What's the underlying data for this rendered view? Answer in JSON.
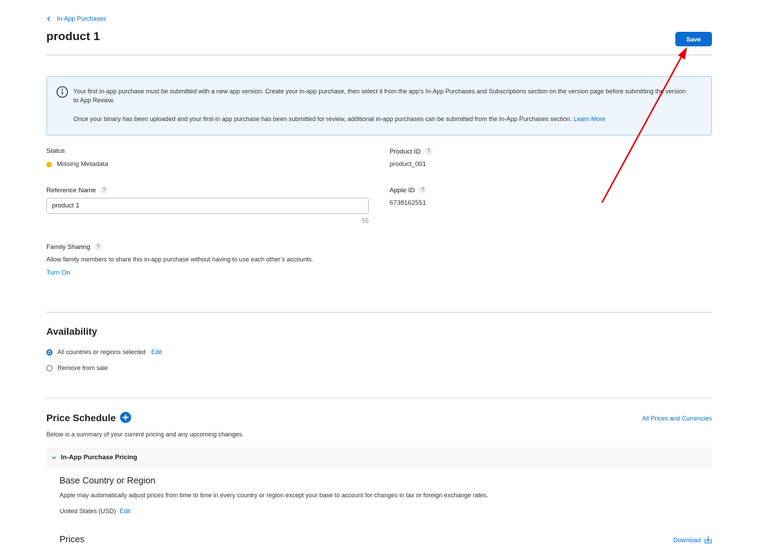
{
  "breadcrumb": {
    "label": "In-App Purchases"
  },
  "page_title": "product 1",
  "toolbar": {
    "save_label": "Save"
  },
  "banner": {
    "line1": "Your first in-app purchase must be submitted with a new app version. Create your in-app purchase, then select it from the app’s In-App Purchases and Subscriptions section on the version page before submitting the version to App Review.",
    "line2": "Once your binary has been uploaded and your first-in app purchase has been submitted for review, additional in-app purchases can be submitted from the In-App Purchases section.",
    "learn_more": "Learn More"
  },
  "status": {
    "label": "Status",
    "value": "Missing Metadata",
    "color": "#f5b800"
  },
  "product_id": {
    "label": "Product ID",
    "value": "product_001"
  },
  "reference_name": {
    "label": "Reference Name",
    "value": "product 1",
    "char_count": "55"
  },
  "apple_id": {
    "label": "Apple ID",
    "value": "6738162551"
  },
  "family_sharing": {
    "label": "Family Sharing",
    "description": "Allow family members to share this in-app purchase without having to use each other’s accounts.",
    "action": "Turn On"
  },
  "availability": {
    "title": "Availability",
    "options": [
      {
        "label": "All countries or regions selected",
        "selected": true,
        "action": "Edit"
      },
      {
        "label": "Remove from sale",
        "selected": false
      }
    ]
  },
  "price_schedule": {
    "title": "Price Schedule",
    "link": "All Prices and Currencies",
    "description": "Below is a summary of your current pricing and any upcoming changes.",
    "section": "In-App Purchase Pricing",
    "base_title": "Base Country or Region",
    "base_description": "Apple may automatically adjust prices from time to time in every country or region except your base to account for changes in tax or foreign exchange rates.",
    "base_value": "United States (USD)",
    "base_edit": "Edit",
    "prices_title": "Prices",
    "download": "Download"
  },
  "colors": {
    "accent": "#0a6ccf",
    "annotation_arrow": "#e8000b"
  }
}
